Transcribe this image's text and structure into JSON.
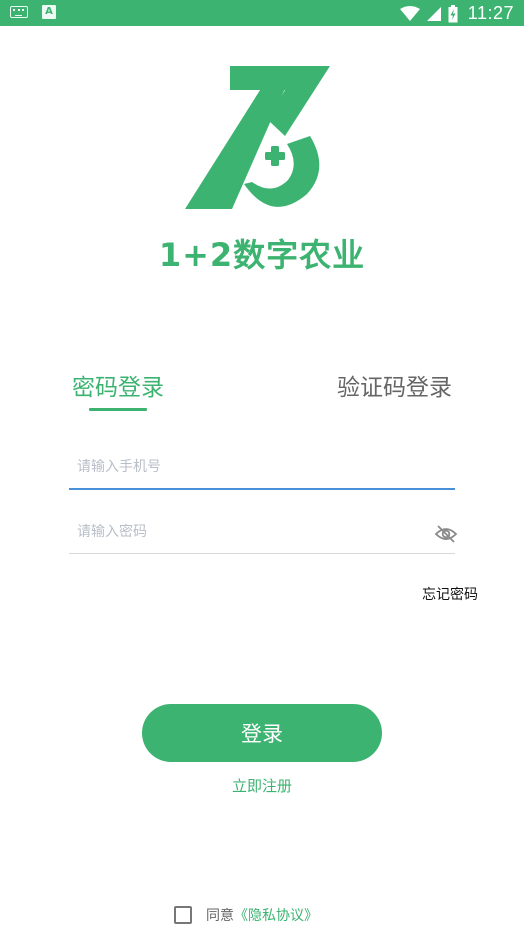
{
  "status_bar": {
    "time": "11:27",
    "icons": [
      "keyboard-icon",
      "a-icon",
      "wifi-icon",
      "signal-icon",
      "battery-icon"
    ]
  },
  "brand": {
    "app_name": "1+2数字农业",
    "logo_icon": "logo-icon"
  },
  "tabs": [
    {
      "label": "密码登录",
      "active": true
    },
    {
      "label": "验证码登录",
      "active": false
    }
  ],
  "form": {
    "phone_placeholder": "请输入手机号",
    "phone_value": "",
    "password_placeholder": "请输入密码",
    "password_value": "",
    "password_toggle_icon": "eye-off-icon",
    "forgot_label": "忘记密码"
  },
  "login_button": "登录",
  "register_link": "立即注册",
  "agreement": {
    "checked": false,
    "text": "同意",
    "link": "《隐私协议》"
  },
  "colors": {
    "primary": "#3cb371",
    "focus_underline": "#4a90d9",
    "tab_inactive": "#666666",
    "placeholder": "#b8bec8"
  }
}
